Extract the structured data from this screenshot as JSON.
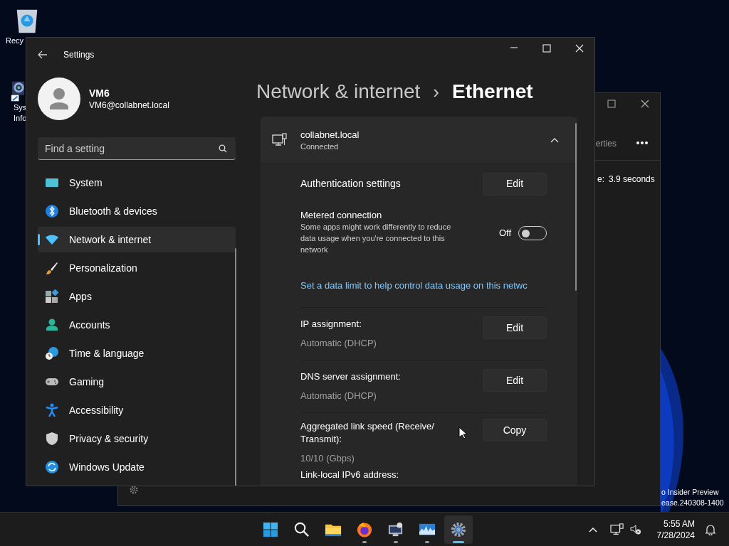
{
  "desktop_icons": [
    {
      "kind": "recycle",
      "lines": [
        "Recy"
      ]
    },
    {
      "kind": "sysinfo",
      "lines": [
        "Sys",
        "Info"
      ]
    }
  ],
  "background_window": {
    "tab_text": "erties",
    "detail_label": "e:",
    "detail_value": "3.9 seconds"
  },
  "build_info": [
    "o Insider Preview",
    "ease.240308-1400"
  ],
  "settings_window": {
    "title": "Settings",
    "user": {
      "name": "VM6",
      "email": "VM6@collabnet.local"
    },
    "search": {
      "placeholder": "Find a setting"
    },
    "nav": [
      {
        "kind": "system",
        "label": "System",
        "selected": false
      },
      {
        "kind": "bluetooth",
        "label": "Bluetooth & devices",
        "selected": false
      },
      {
        "kind": "network",
        "label": "Network & internet",
        "selected": true
      },
      {
        "kind": "personalization",
        "label": "Personalization",
        "selected": false
      },
      {
        "kind": "apps",
        "label": "Apps",
        "selected": false
      },
      {
        "kind": "accounts",
        "label": "Accounts",
        "selected": false
      },
      {
        "kind": "time",
        "label": "Time & language",
        "selected": false
      },
      {
        "kind": "gaming",
        "label": "Gaming",
        "selected": false
      },
      {
        "kind": "accessibility",
        "label": "Accessibility",
        "selected": false
      },
      {
        "kind": "privacy",
        "label": "Privacy & security",
        "selected": false
      },
      {
        "kind": "update",
        "label": "Windows Update",
        "selected": false
      }
    ],
    "breadcrumb": {
      "parent": "Network & internet",
      "separator": "›",
      "current": "Ethernet"
    },
    "connection": {
      "name": "collabnet.local",
      "status": "Connected",
      "expanded": true
    },
    "rows": [
      {
        "kind": "button",
        "label": "Authentication settings",
        "button": "Edit"
      },
      {
        "kind": "toggle",
        "label": "Metered connection",
        "description": "Some apps might work differently to reduce data usage when you're connected to this network",
        "state_label": "Off",
        "on": false,
        "link": "Set a data limit to help control data usage on this netwc"
      },
      {
        "kind": "value",
        "label": "IP assignment:",
        "value": "Automatic (DHCP)",
        "button": "Edit"
      },
      {
        "kind": "value",
        "label": "DNS server assignment:",
        "value": "Automatic (DHCP)",
        "button": "Edit"
      },
      {
        "kind": "value",
        "label": "Aggregated link speed (Receive/ Transmit):",
        "value": "10/10 (Gbps)",
        "button": "Copy"
      },
      {
        "kind": "label",
        "label": "Link-local IPv6 address:"
      }
    ]
  },
  "taskbar": {
    "apps": [
      {
        "kind": "start",
        "selected": false,
        "running": false
      },
      {
        "kind": "search",
        "selected": false,
        "running": false
      },
      {
        "kind": "explorer",
        "selected": false,
        "running": false
      },
      {
        "kind": "firefox",
        "selected": false,
        "running": true
      },
      {
        "kind": "remote",
        "selected": false,
        "running": true
      },
      {
        "kind": "monitor",
        "selected": false,
        "running": true
      },
      {
        "kind": "settings",
        "selected": true,
        "running": true
      }
    ],
    "time": "5:55 AM",
    "date": "7/28/2024"
  }
}
